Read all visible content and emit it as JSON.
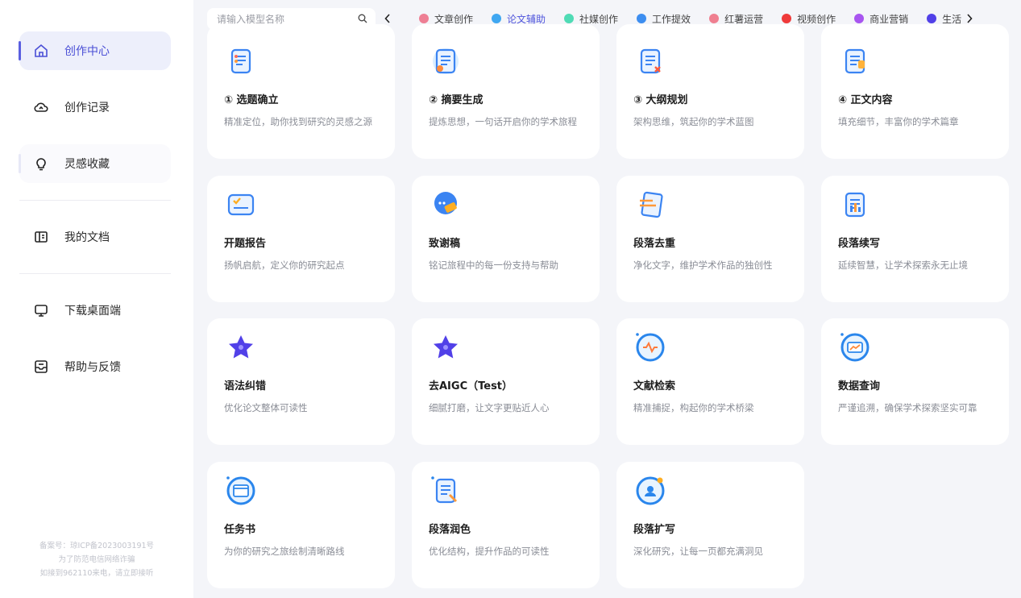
{
  "sidebar": {
    "items": [
      {
        "label": "创作中心",
        "icon": "home-icon"
      },
      {
        "label": "创作记录",
        "icon": "cloud-icon"
      },
      {
        "label": "灵感收藏",
        "icon": "lightbulb-icon"
      },
      {
        "label": "我的文档",
        "icon": "document-icon"
      },
      {
        "label": "下载桌面端",
        "icon": "monitor-icon"
      },
      {
        "label": "帮助与反馈",
        "icon": "feedback-icon"
      }
    ],
    "beian": [
      "备案号：琼ICP备2023003191号",
      "为了防范电信网络诈骗",
      "如接到962110来电，请立即接听"
    ]
  },
  "search": {
    "placeholder": "请输入模型名称"
  },
  "tabs": [
    {
      "label": "文章创作",
      "color": "#ee7f94"
    },
    {
      "label": "论文辅助",
      "color": "#3fa7f1"
    },
    {
      "label": "社媒创作",
      "color": "#4fdbb5"
    },
    {
      "label": "工作提效",
      "color": "#3d8ef0"
    },
    {
      "label": "红薯运营",
      "color": "#ef7f90"
    },
    {
      "label": "视频创作",
      "color": "#ef3a3a"
    },
    {
      "label": "商业营销",
      "color": "#a855f0"
    },
    {
      "label": "生活",
      "color": "#5140e8"
    }
  ],
  "active_tab": "论文辅助",
  "cards": [
    {
      "title": "① 选题确立",
      "desc": "精准定位，助你找到研究的灵感之源",
      "icon": "topic-icon"
    },
    {
      "title": "② 摘要生成",
      "desc": "提炼思想，一句话开启你的学术旅程",
      "icon": "abstract-icon"
    },
    {
      "title": "③ 大纲规划",
      "desc": "架构思维，筑起你的学术蓝图",
      "icon": "outline-icon"
    },
    {
      "title": "④ 正文内容",
      "desc": "填充细节，丰富你的学术篇章",
      "icon": "content-icon"
    },
    {
      "title": "开题报告",
      "desc": "扬帆启航，定义你的研究起点",
      "icon": "report-icon"
    },
    {
      "title": "致谢稿",
      "desc": "铭记旅程中的每一份支持与帮助",
      "icon": "thanks-icon"
    },
    {
      "title": "段落去重",
      "desc": "净化文字，维护学术作品的独创性",
      "icon": "dedupe-icon"
    },
    {
      "title": "段落续写",
      "desc": "延续智慧，让学术探索永无止境",
      "icon": "continue-icon"
    },
    {
      "title": "语法纠错",
      "desc": "优化论文整体可读性",
      "icon": "star-icon"
    },
    {
      "title": "去AIGC（Test）",
      "desc": "细腻打磨，让文字更贴近人心",
      "icon": "star-icon"
    },
    {
      "title": "文献检索",
      "desc": "精准捕捉，构起你的学术桥梁",
      "icon": "literature-search-icon"
    },
    {
      "title": "数据查询",
      "desc": "严谨追溯，确保学术探索坚实可靠",
      "icon": "data-query-icon"
    },
    {
      "title": "任务书",
      "desc": "为你的研究之旅绘制清晰路线",
      "icon": "task-icon"
    },
    {
      "title": "段落润色",
      "desc": "优化结构，提升作品的可读性",
      "icon": "polish-icon"
    },
    {
      "title": "段落扩写",
      "desc": "深化研究，让每一页都充满洞见",
      "icon": "expand-icon"
    }
  ]
}
